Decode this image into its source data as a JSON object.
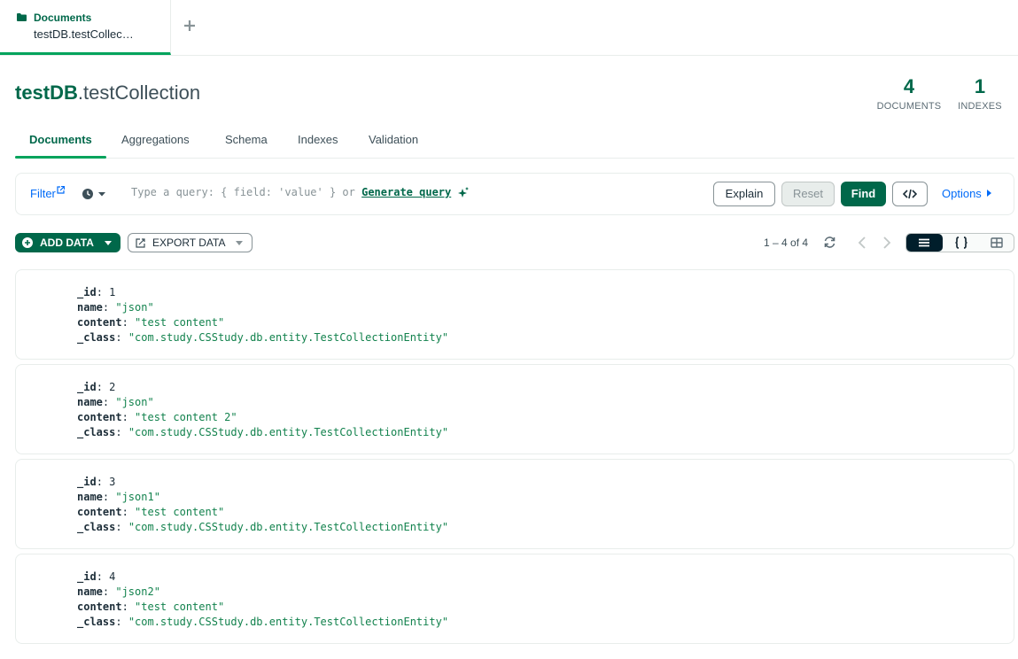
{
  "workspace_tab": {
    "title": "Documents",
    "subtitle": "testDB.testCollec…"
  },
  "header": {
    "db": "testDB",
    "sep": ".",
    "collection": "testCollection",
    "documents_count": "4",
    "documents_label": "DOCUMENTS",
    "indexes_count": "1",
    "indexes_label": "INDEXES"
  },
  "tabs": [
    "Documents",
    "Aggregations",
    "Schema",
    "Indexes",
    "Validation"
  ],
  "query": {
    "filter_label": "Filter",
    "placeholder": "Type a query: { field: 'value' } or ",
    "generate_label": "Generate query",
    "explain": "Explain",
    "reset": "Reset",
    "find": "Find",
    "options": "Options"
  },
  "toolbar": {
    "add_data": "ADD DATA",
    "export_data": "EXPORT DATA",
    "pagination": "1 – 4 of 4"
  },
  "documents": [
    {
      "_id": "1",
      "name": "\"json\"",
      "content": "\"test content\"",
      "_class": "\"com.study.CSStudy.db.entity.TestCollectionEntity\""
    },
    {
      "_id": "2",
      "name": "\"json\"",
      "content": "\"test content 2\"",
      "_class": "\"com.study.CSStudy.db.entity.TestCollectionEntity\""
    },
    {
      "_id": "3",
      "name": "\"json1\"",
      "content": "\"test content\"",
      "_class": "\"com.study.CSStudy.db.entity.TestCollectionEntity\""
    },
    {
      "_id": "4",
      "name": "\"json2\"",
      "content": "\"test content\"",
      "_class": "\"com.study.CSStudy.db.entity.TestCollectionEntity\""
    }
  ],
  "field_keys": {
    "id": "_id",
    "name": "name",
    "content": "content",
    "class": "_class"
  },
  "colors": {
    "brand": "#00684a",
    "accent": "#00a35c",
    "link": "#016bf8",
    "string": "#12824d"
  },
  "icons": [
    "folder-icon",
    "plus-icon",
    "external-link-icon",
    "history-icon",
    "sparkle-icon",
    "code-icon",
    "caret-right-icon",
    "refresh-icon",
    "chevron-left-icon",
    "chevron-right-icon",
    "list-view-icon",
    "json-view-icon",
    "table-view-icon",
    "export-icon"
  ]
}
